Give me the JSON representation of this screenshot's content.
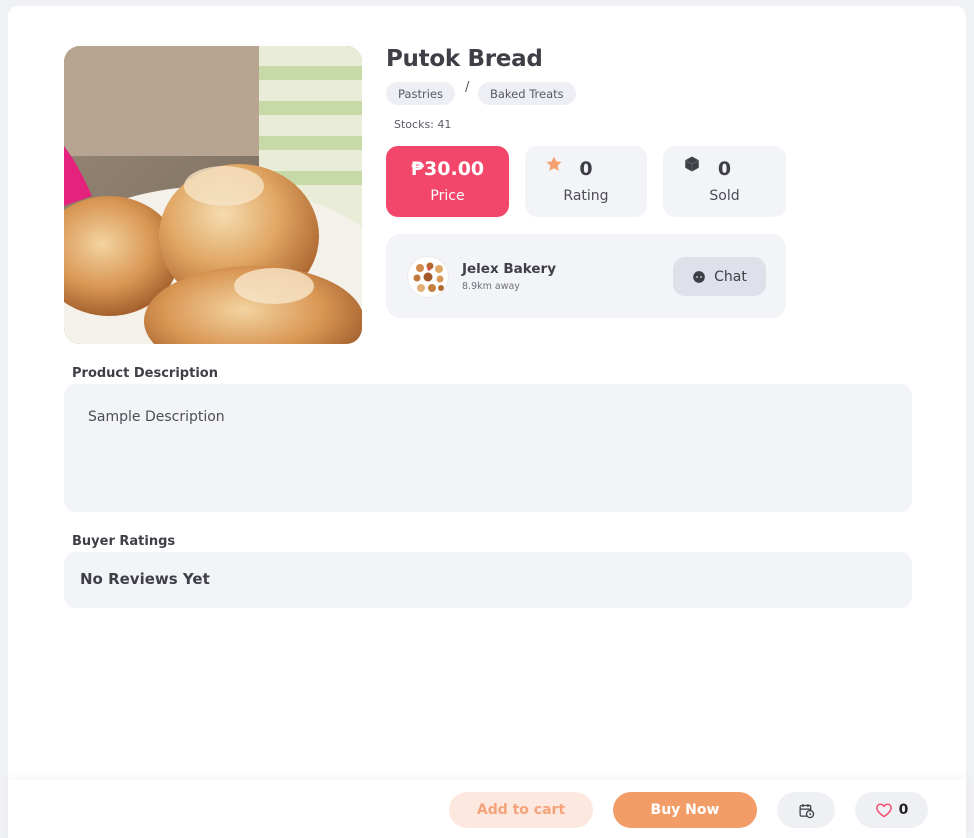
{
  "product": {
    "title": "Putok Bread",
    "categories": [
      "Pastries",
      "Baked Treats"
    ],
    "category_separator": "/",
    "stocks": "Stocks: 41",
    "image_icon": "product-photo"
  },
  "stats": {
    "price": {
      "value": "₱30.00",
      "label": "Price"
    },
    "rating": {
      "value": "0",
      "label": "Rating",
      "icon": "star-icon"
    },
    "sold": {
      "value": "0",
      "label": "Sold",
      "icon": "box-icon"
    }
  },
  "seller": {
    "name": "Jelex Bakery",
    "distance": "8.9km away",
    "chat_label": "Chat"
  },
  "description": {
    "heading": "Product Description",
    "text": "Sample Description"
  },
  "ratings": {
    "heading": "Buyer Ratings",
    "empty_text": "No Reviews Yet"
  },
  "actions": {
    "add_to_cart": "Add to cart",
    "buy_now": "Buy Now",
    "favorites_count": "0"
  },
  "colors": {
    "price_accent": "#f2476a",
    "buy_accent": "#f29c67",
    "cart_bg": "#fde8df",
    "star": "#f4a06f"
  }
}
